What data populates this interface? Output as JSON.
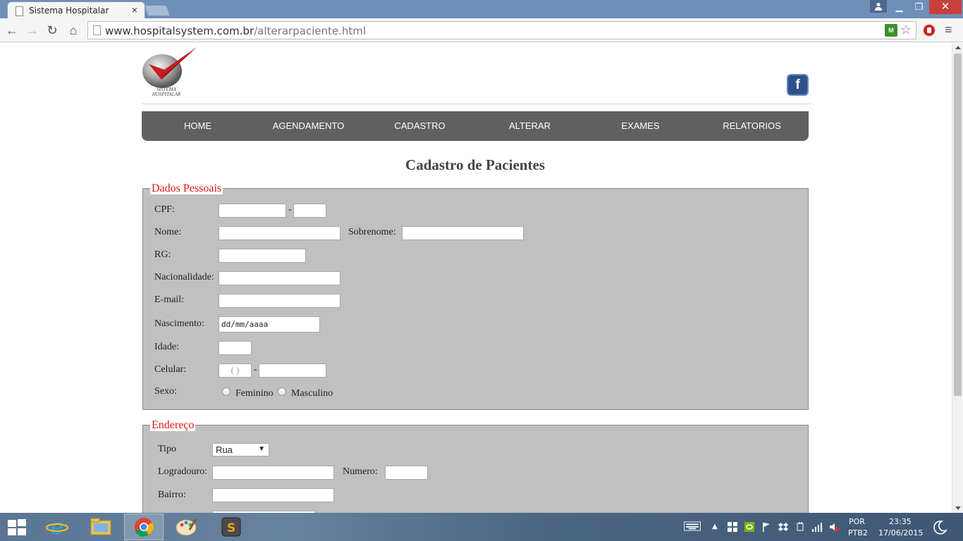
{
  "browser": {
    "tab_title": "Sistema Hospitalar",
    "tab_close": "×",
    "url_host": "www.hospitalsystem.com.br",
    "url_path": "/alterarpaciente.html",
    "window_buttons": {
      "minimize": "▁",
      "maximize": "❐",
      "close": "✕"
    },
    "nav": {
      "back": "←",
      "forward": "→",
      "reload": "↻",
      "home": "⌂"
    },
    "menu": "≡"
  },
  "site": {
    "logo_text": "SISTEMA HOSPITALAR",
    "facebook": "f",
    "nav": [
      "HOME",
      "AGENDAMENTO",
      "CADASTRO",
      "ALTERAR",
      "EXAMES",
      "RELATORIOS"
    ]
  },
  "form": {
    "title": "Cadastro de Pacientes",
    "dados_pessoais": {
      "legend": "Dados Pessoais",
      "cpf": "CPF:",
      "cpf_sep": "-",
      "nome": "Nome:",
      "sobrenome": "Sobrenome:",
      "rg": "RG:",
      "nacionalidade": "Nacionalidade:",
      "email": "E-mail:",
      "nascimento": "Nascimento:",
      "nascimento_placeholder": "dd/mm/aaaa",
      "idade": "Idade:",
      "celular": "Celular:",
      "celular_ddd": "(  )",
      "celular_sep": "-",
      "sexo": "Sexo:",
      "feminino": "Feminino",
      "masculino": "Masculino"
    },
    "endereco": {
      "legend": "Endereço",
      "tipo": "Tipo",
      "tipo_value": "Rua",
      "logradouro": "Logradouro:",
      "numero": "Numero:",
      "bairro": "Bairro:"
    }
  },
  "taskbar": {
    "language": "POR",
    "layout": "PTB2",
    "time": "23:35",
    "date": "17/06/2015",
    "apps": [
      "internet-explorer",
      "file-explorer",
      "chrome",
      "paint",
      "sublime-text"
    ]
  },
  "colors": {
    "nav_bg": "#606060",
    "fieldset_bg": "#c0c0c0",
    "legend": "#e01515",
    "title": "#444444"
  }
}
